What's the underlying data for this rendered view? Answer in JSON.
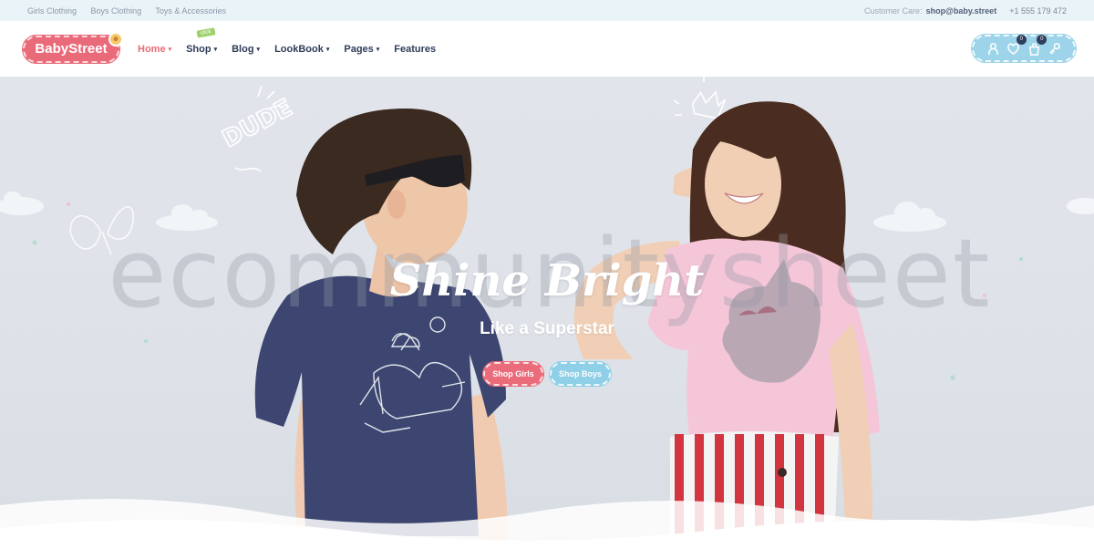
{
  "topbar": {
    "links": [
      "Girls Clothing",
      "Boys Clothing",
      "Toys & Accessories"
    ],
    "customer_care_label": "Customer Care:",
    "customer_care_email": "shop@baby.street",
    "phone": "+1 555 179 472"
  },
  "header": {
    "logo_text": "BabyStreet",
    "nav": [
      {
        "label": "Home",
        "active": true
      },
      {
        "label": "Shop",
        "tag": "click"
      },
      {
        "label": "Blog"
      },
      {
        "label": "LookBook"
      },
      {
        "label": "Pages"
      },
      {
        "label": "Features"
      }
    ],
    "wishlist_count": "0",
    "cart_count": "0",
    "icons": [
      "user-icon",
      "heart-icon",
      "shopping-bag-icon",
      "key-icon"
    ]
  },
  "hero": {
    "watermark": "ecommunitysheet",
    "headline": "Shine Bright",
    "subline": "Like a Superstar",
    "button_girls": "Shop Girls",
    "button_boys": "Shop Boys",
    "doodle_text": "DUDE"
  },
  "colors": {
    "accent_pink": "#e96a79",
    "accent_blue": "#9dd4ea",
    "nav_dark": "#2f3d5a",
    "topbar_bg": "#eaf3f8"
  }
}
